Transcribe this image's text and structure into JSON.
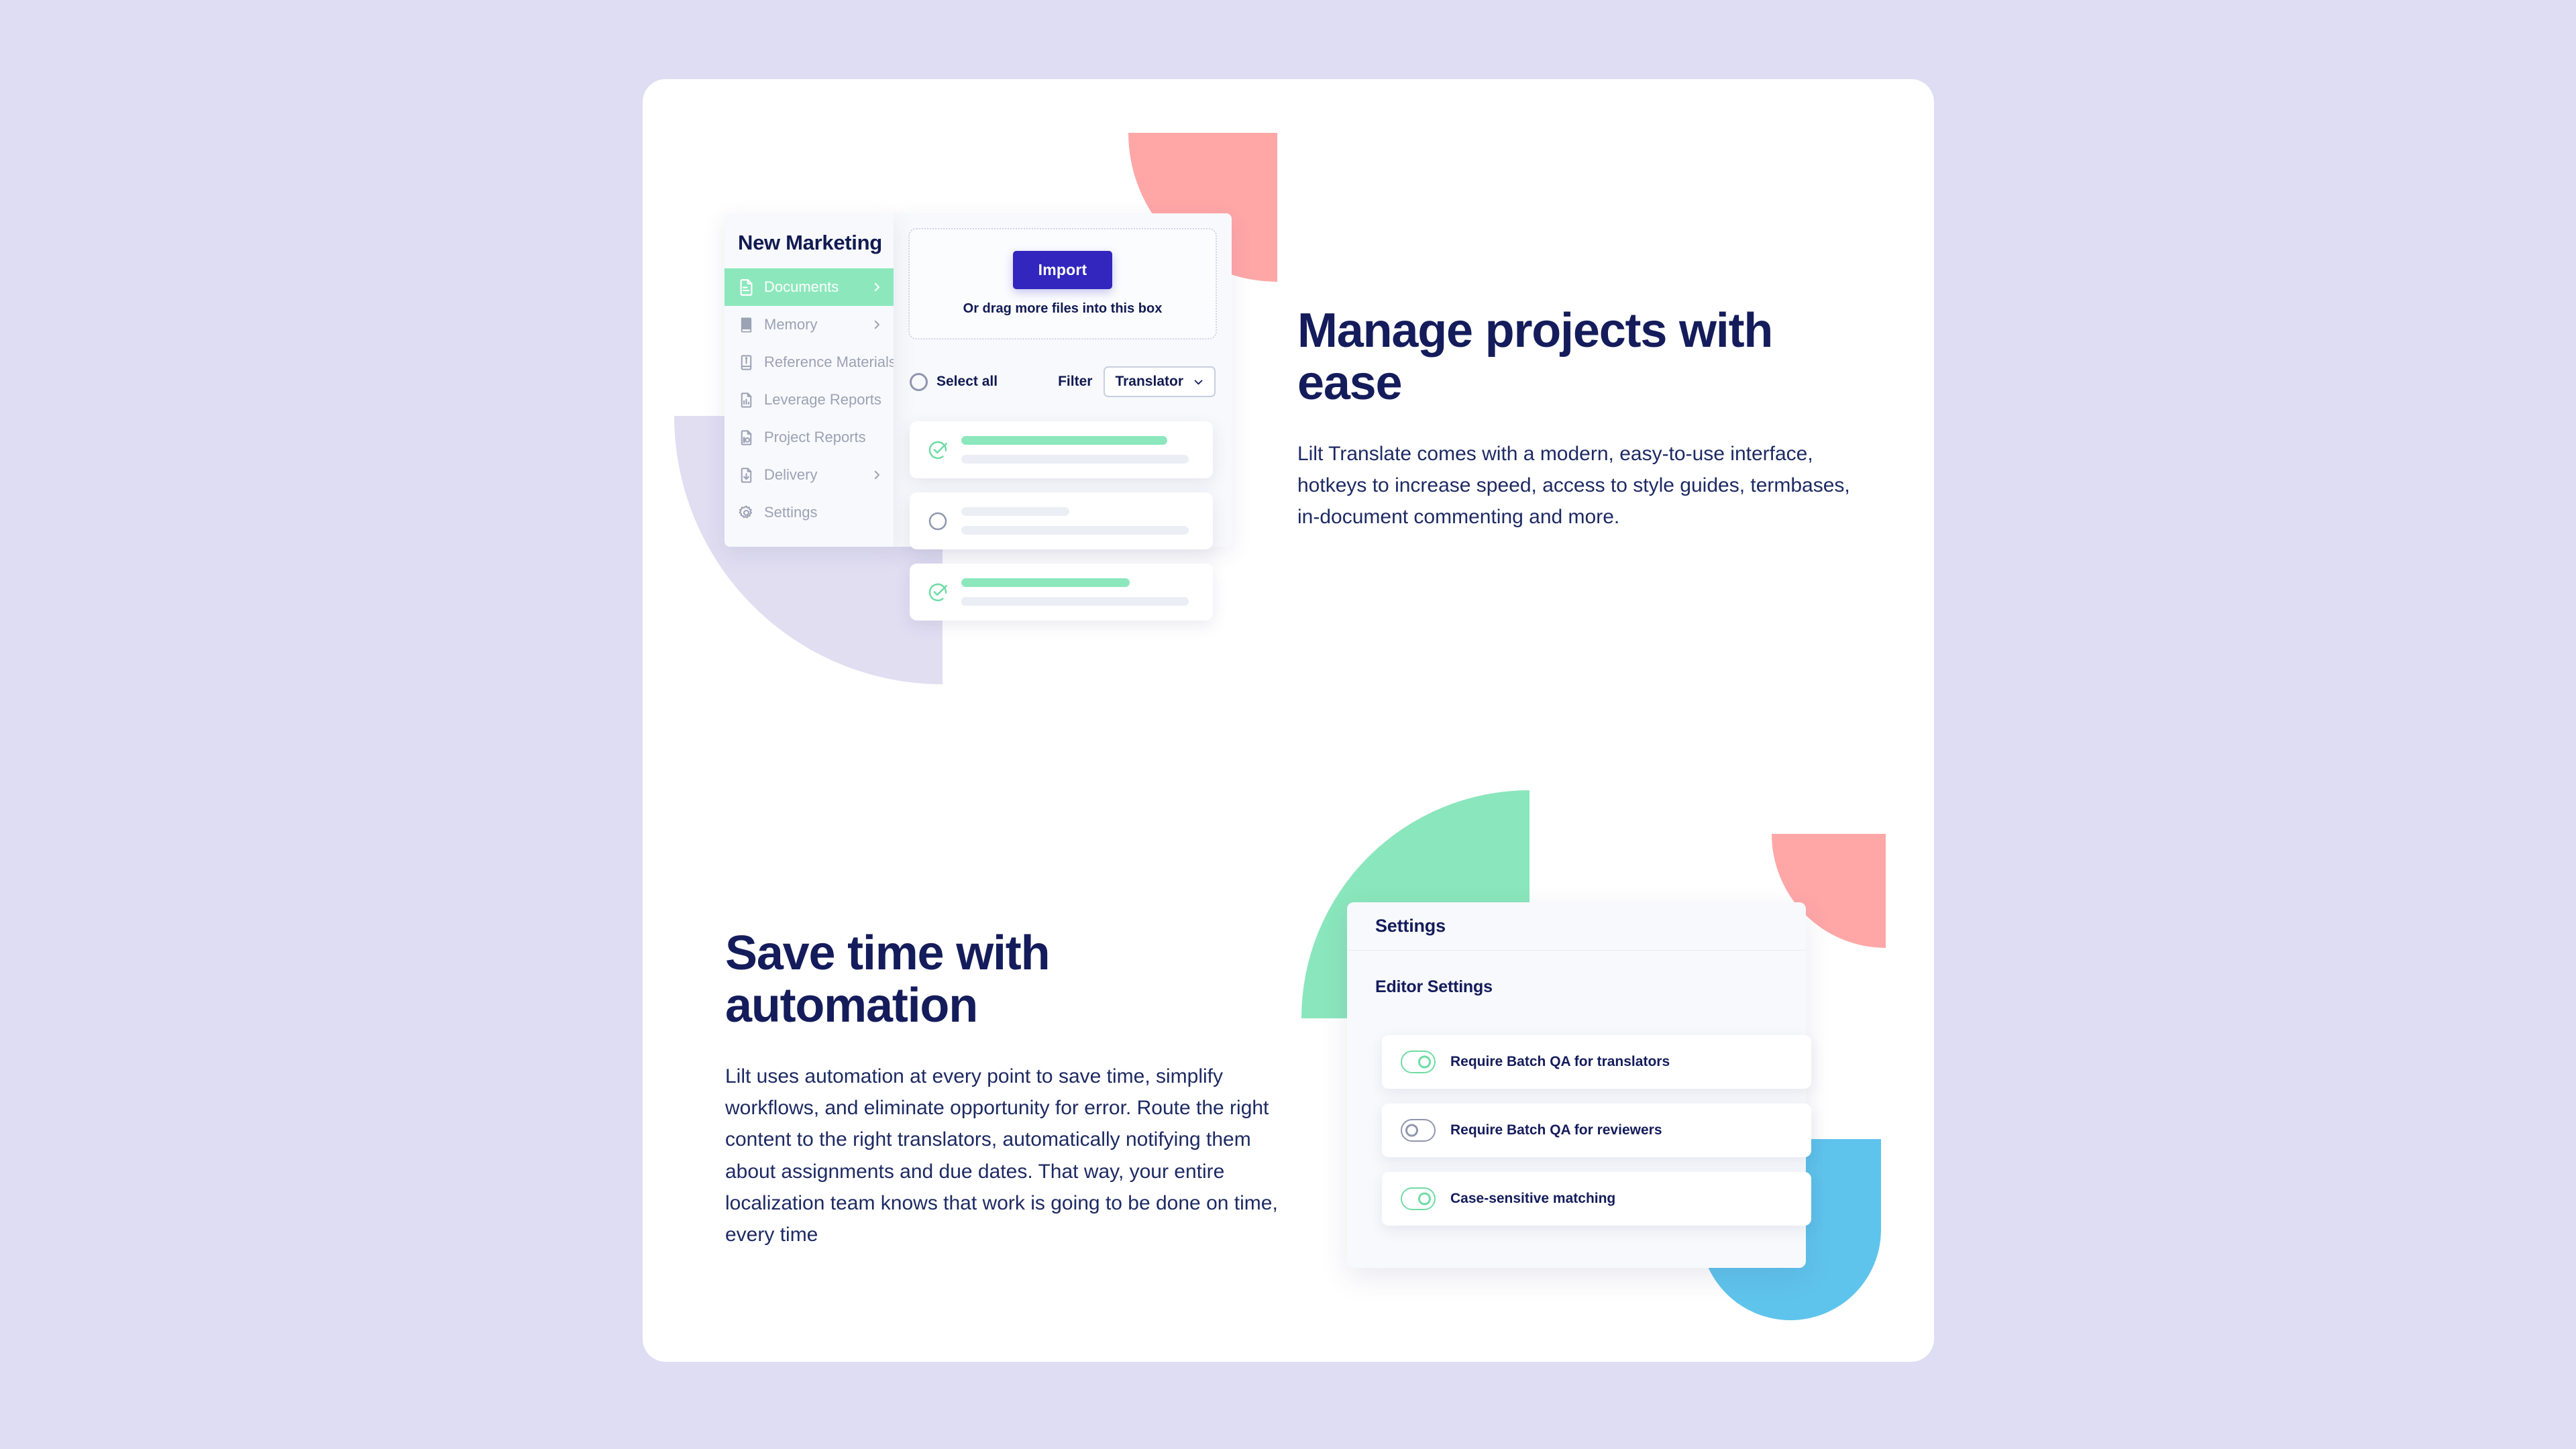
{
  "page": {
    "background_color": "#dfddf3",
    "card_color": "#ffffff"
  },
  "decor": {
    "pink": "#ffa7a7",
    "green": "#8ae6bc",
    "blue": "#5fc4ec",
    "lavender": "#d8d5ee"
  },
  "documents_mock": {
    "project_title": "New Marketing",
    "nav_items": [
      {
        "label": "Documents",
        "icon": "document-icon",
        "active": true,
        "chevron": true
      },
      {
        "label": "Memory",
        "icon": "book-icon",
        "active": false,
        "chevron": true
      },
      {
        "label": "Reference Materials",
        "icon": "reference-book-icon",
        "active": false,
        "chevron": false
      },
      {
        "label": "Leverage Reports",
        "icon": "bar-chart-document-icon",
        "active": false,
        "chevron": false
      },
      {
        "label": "Project Reports",
        "icon": "pie-chart-document-icon",
        "active": false,
        "chevron": false
      },
      {
        "label": "Delivery",
        "icon": "download-document-icon",
        "active": false,
        "chevron": true
      },
      {
        "label": "Settings",
        "icon": "gear-icon",
        "active": false,
        "chevron": false
      }
    ],
    "dropzone": {
      "import_label": "Import",
      "hint": "Or drag more files into this box",
      "import_color": "#3226be"
    },
    "filter_bar": {
      "select_all_label": "Select all",
      "select_all_checked": false,
      "filter_label": "Filter",
      "filter_value": "Translator"
    },
    "rows": [
      {
        "checked": true,
        "primary_bar": "green",
        "primary_width": "88%",
        "secondary_width": "97%"
      },
      {
        "checked": false,
        "primary_bar": "grey",
        "primary_width": "46%",
        "secondary_width": "97%"
      },
      {
        "checked": true,
        "primary_bar": "green",
        "primary_width": "72%",
        "secondary_width": "97%"
      }
    ]
  },
  "section_top": {
    "headline": "Manage projects with ease",
    "body": "Lilt Translate comes with a modern, easy-to-use interface, hotkeys to increase speed, access to style guides, termbases, in-document commenting and more."
  },
  "section_bottom": {
    "headline": "Save time with automation",
    "body": "Lilt uses automation at every point to save time, simplify workflows, and eliminate opportunity for error. Route the right content to the right translators, automatically notifying them about assignments and due dates. That way, your entire localization team knows that work is going to be done on time, every time"
  },
  "settings_mock": {
    "header_title": "Settings",
    "section_title": "Editor Settings",
    "toggles": [
      {
        "label": "Require Batch QA for translators",
        "on": true
      },
      {
        "label": "Require Batch QA for reviewers",
        "on": false
      },
      {
        "label": "Case-sensitive matching",
        "on": true
      }
    ]
  }
}
